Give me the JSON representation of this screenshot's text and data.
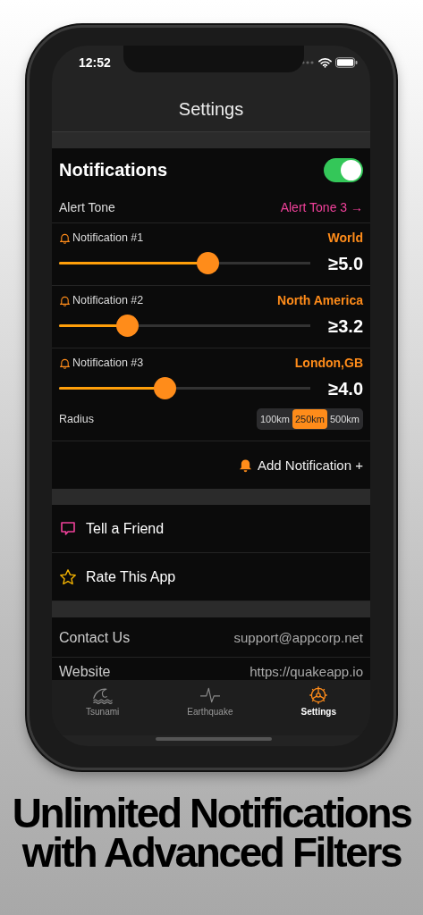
{
  "status_bar": {
    "time": "12:52"
  },
  "nav": {
    "title": "Settings"
  },
  "notifications": {
    "title": "Notifications",
    "enabled": true,
    "alert_tone": {
      "label": "Alert Tone",
      "value": "Alert Tone 3 →"
    },
    "items": [
      {
        "label": "Notification #1",
        "region": "World",
        "level": 0.59,
        "magnitude": "≥5.0"
      },
      {
        "label": "Notification #2",
        "region": "North America",
        "level": 0.27,
        "magnitude": "≥3.2"
      },
      {
        "label": "Notification #3",
        "region": "London,GB",
        "level": 0.42,
        "magnitude": "≥4.0",
        "radius": {
          "label": "Radius",
          "options": [
            {
              "label": "100km",
              "selected": false
            },
            {
              "label": "250km",
              "selected": true
            },
            {
              "label": "500km",
              "selected": false
            }
          ]
        }
      }
    ],
    "add_button": "Add Notification +"
  },
  "actions": [
    {
      "label": "Tell a Friend",
      "kind": "share"
    },
    {
      "label": "Rate This App",
      "kind": "rate"
    }
  ],
  "info": [
    {
      "label": "Contact Us",
      "value": "support@appcorp.net"
    },
    {
      "label": "Website",
      "value": "https://quakeapp.io"
    }
  ],
  "tab_bar": [
    {
      "label": "Tsunami",
      "kind": "tsunami",
      "selected": false
    },
    {
      "label": "Earthquake",
      "kind": "earthquake",
      "selected": false
    },
    {
      "label": "Settings",
      "kind": "settings",
      "selected": true
    }
  ],
  "headline": [
    "Unlimited Notifications",
    "with Advanced Filters"
  ]
}
